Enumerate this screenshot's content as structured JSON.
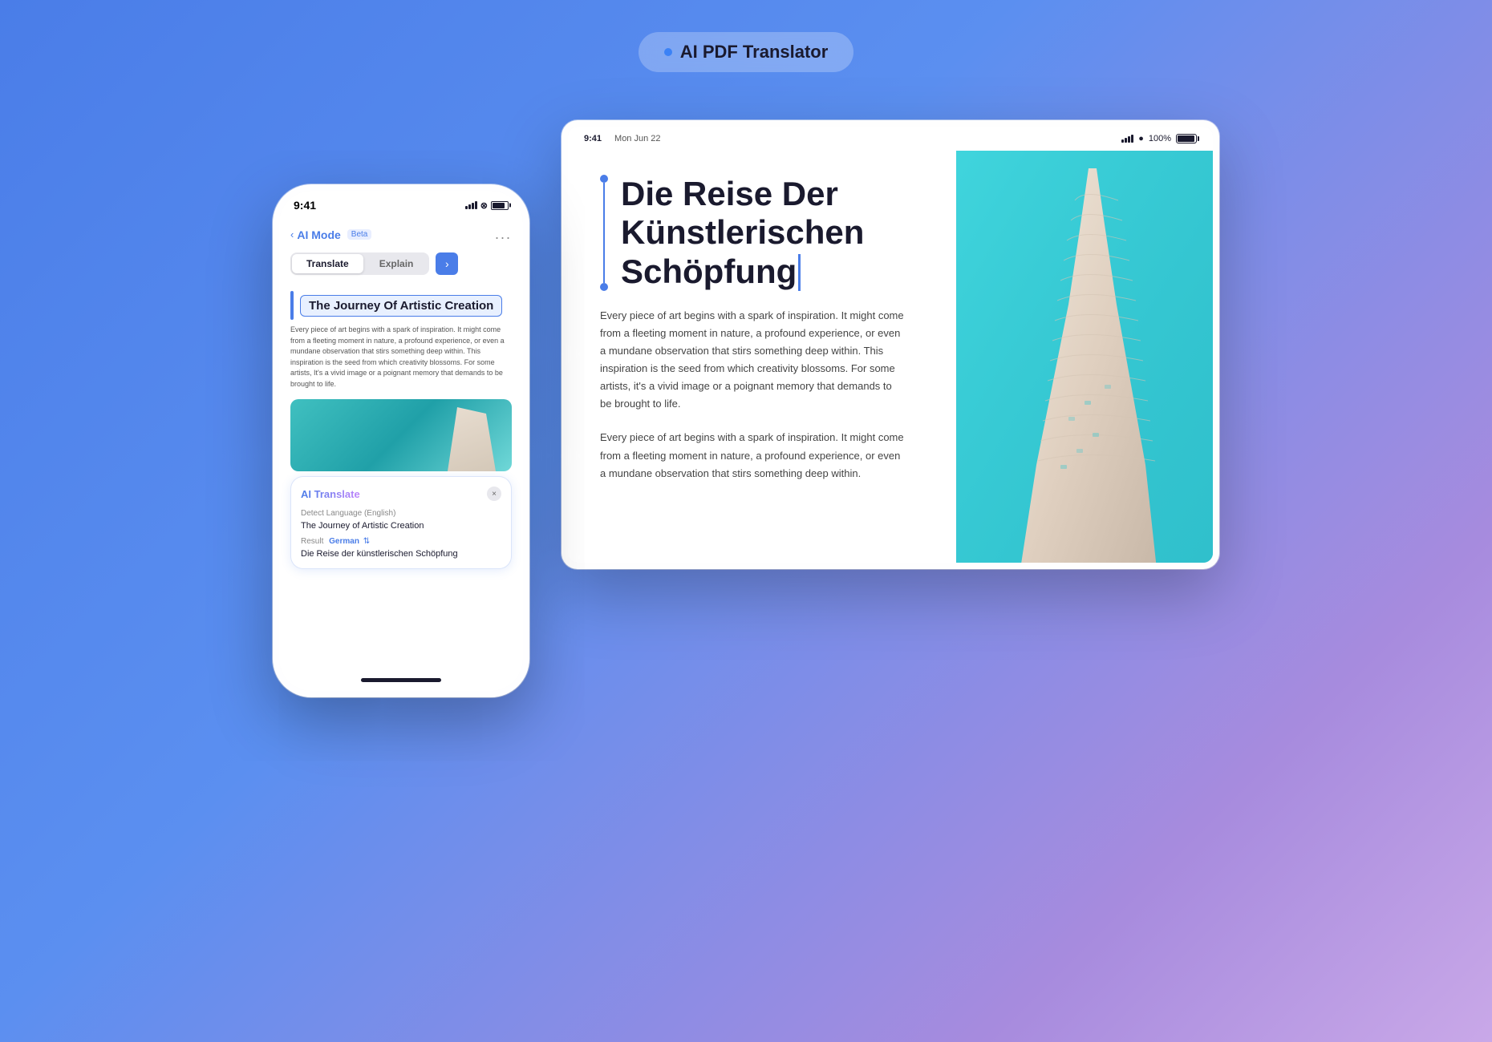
{
  "page": {
    "badge": {
      "dot_color": "#3b82f6",
      "label": "AI PDF Translator"
    }
  },
  "phone": {
    "status_bar": {
      "time": "9:41"
    },
    "nav": {
      "back_text": "‹",
      "ai_mode_label": "AI Mode",
      "beta_label": "Beta",
      "dots": "..."
    },
    "tabs": {
      "translate_label": "Translate",
      "explain_label": "Explain",
      "arrow": "›"
    },
    "doc_title": "The Journey Of Artistic Creation",
    "doc_body": "Every piece of art begins with a spark of inspiration. It might come from a fleeting moment in nature, a profound experience, or even a mundane observation that stirs something deep within. This inspiration is the seed from which creativity blossoms. For some artists, It's a vivid image or a poignant memory that demands to be brought to life.",
    "ai_panel": {
      "title": "AI Translate",
      "close_label": "×",
      "detect_lang_label": "Detect Language (English)",
      "source_text": "The Journey of Artistic Creation",
      "result_label": "Result",
      "result_lang": "German",
      "result_text": "Die Reise der künstlerischen Schöpfung"
    }
  },
  "tablet": {
    "status_bar": {
      "time": "9:41",
      "date": "Mon Jun 22",
      "battery": "100%"
    },
    "doc": {
      "title_line1": "Die Reise Der",
      "title_line2": "Künstlerischen",
      "title_line3": "Schöpfung",
      "body1": "Every piece of art begins with a spark of inspiration. It might come from a fleeting moment in nature, a profound experience, or even a mundane observation that stirs something deep within. This inspiration is the seed from which creativity blossoms. For some artists, it's a vivid image or a poignant memory that demands to be brought to life.",
      "body2": "Every piece of art begins with a spark of inspiration. It might come from a fleeting moment in nature, a profound experience, or even a mundane observation that stirs something deep within."
    }
  }
}
